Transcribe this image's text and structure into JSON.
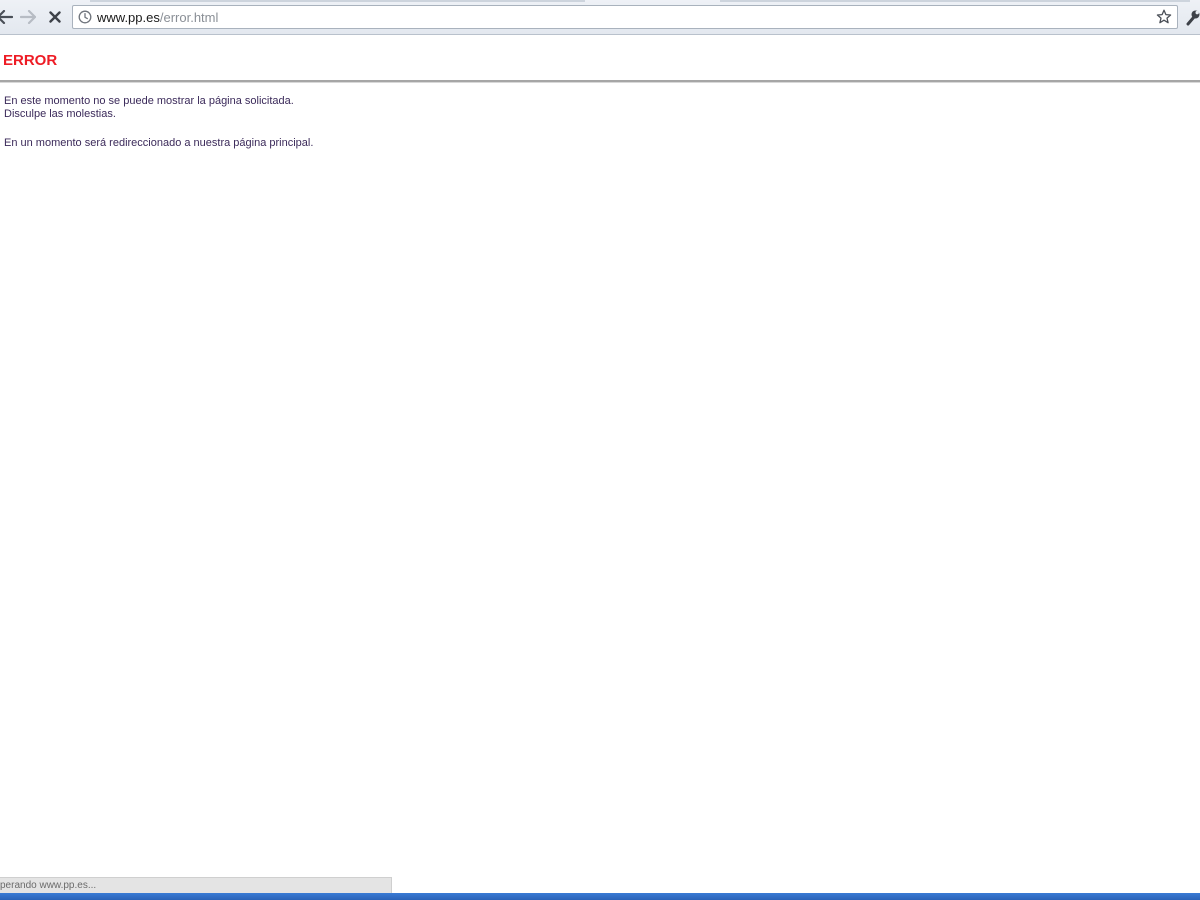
{
  "browser": {
    "url_host": "www.pp.es",
    "url_path": "/error.html",
    "icons": {
      "back": "arrow-left-icon",
      "forward": "arrow-right-icon",
      "stop": "close-icon",
      "page_info": "page-info-icon",
      "bookmark": "star-icon",
      "menu": "wrench-icon"
    }
  },
  "page": {
    "title": "ERROR",
    "line1": "En este momento no se puede mostrar la página solicitada.",
    "line2": "Disculpe las molestias.",
    "line3": "En un momento será redireccionado a nuestra página principal."
  },
  "status": {
    "text": "perando www.pp.es..."
  },
  "colors": {
    "error_title": "#ee1c25",
    "body_text": "#3b2a5a",
    "rule": "#a6a6a6"
  }
}
